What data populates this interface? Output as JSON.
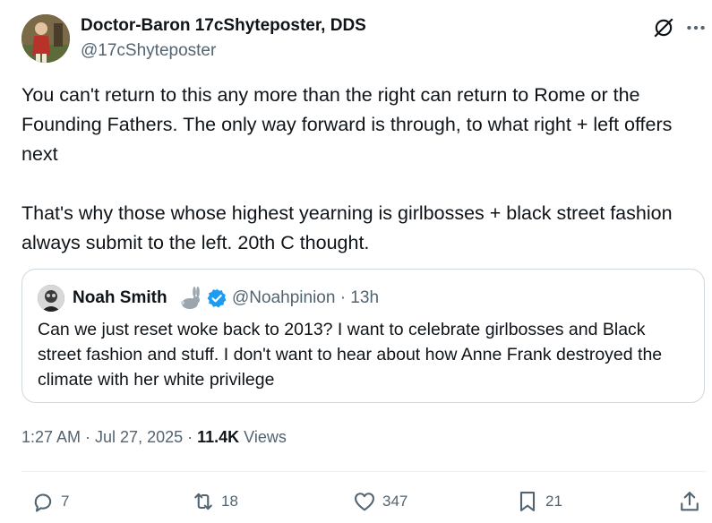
{
  "tweet": {
    "author_name": "Doctor-Baron 17cShyteposter, DDS",
    "author_handle": "@17cShyteposter",
    "text_p1": "You can't return to this any more than the right can return to Rome or the Founding Fathers. The only way forward is through, to what right + left offers next",
    "text_p2": "That's why those whose highest yearning is girlbosses + black street fashion always submit to the left. 20th C thought."
  },
  "quote": {
    "name": "Noah Smith",
    "handle_time": "@Noahpinion · 13h",
    "text": "Can we just reset woke back to 2013? I want to celebrate girlbosses and Black street fashion and stuff. I don't want to hear about how Anne Frank destroyed the climate with her white privilege"
  },
  "meta": {
    "time_date": "1:27 AM · Jul 27, 2025 · ",
    "views_count": "11.4K",
    "views_label": " Views"
  },
  "actions": {
    "replies": "7",
    "reposts": "18",
    "likes": "347",
    "bookmarks": "21"
  },
  "icons": {
    "header": [
      "grok-icon",
      "more-icon"
    ],
    "actions": [
      "reply-icon",
      "repost-icon",
      "like-icon",
      "bookmark-icon",
      "share-icon"
    ]
  },
  "colors": {
    "text": "#0f1419",
    "secondary": "#536471",
    "border": "#cfd9de",
    "verified": "#1d9bf0"
  }
}
